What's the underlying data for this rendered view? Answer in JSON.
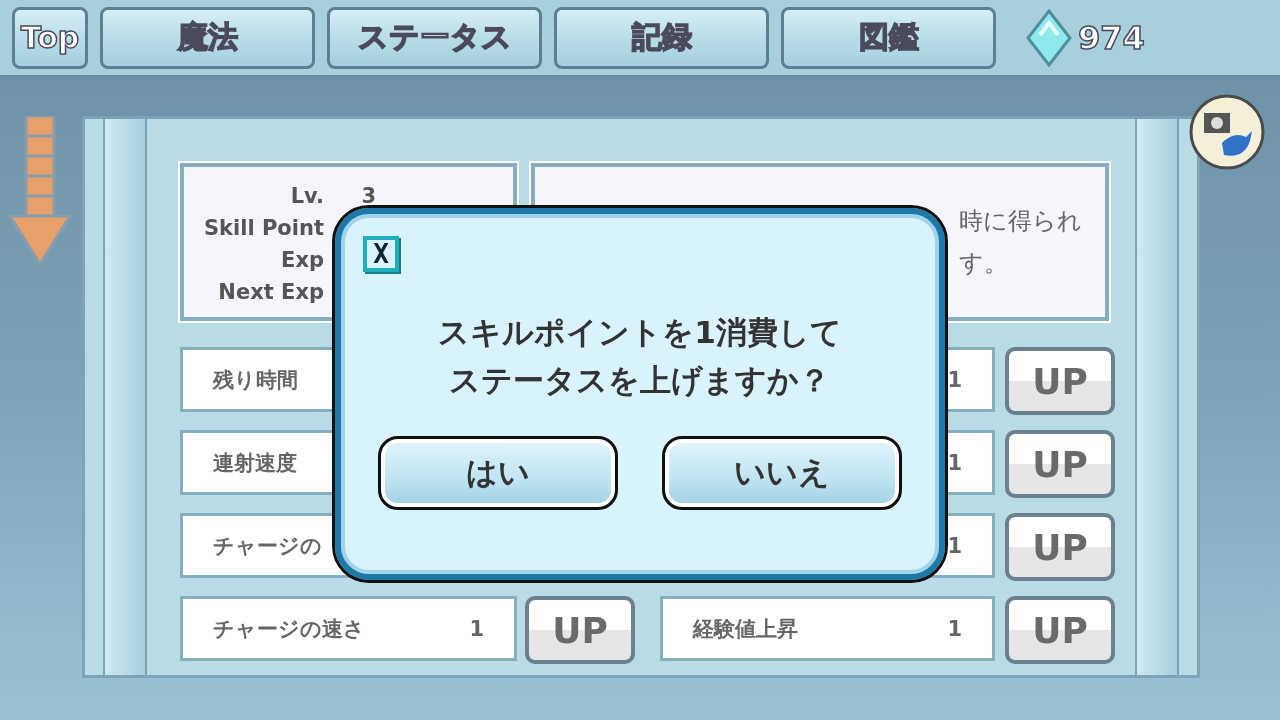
{
  "nav": {
    "top": "Top",
    "tabs": [
      "魔法",
      "ステータス",
      "記録",
      "図鑑"
    ],
    "gems": "974"
  },
  "info": {
    "lines": [
      {
        "label": "Lv.",
        "value": "3"
      },
      {
        "label": "Skill Point"
      },
      {
        "label": "Exp"
      },
      {
        "label": "Next Exp"
      }
    ],
    "description": [
      "時に得られ",
      "す。"
    ]
  },
  "stats": {
    "left": [
      {
        "name": "残り時間"
      },
      {
        "name": "連射速度"
      },
      {
        "name": "チャージの"
      },
      {
        "name": "チャージの速さ",
        "value": "1",
        "button": "UP"
      }
    ],
    "right": [
      {
        "value": "1",
        "button": "UP"
      },
      {
        "value": "1",
        "button": "UP"
      },
      {
        "value": "1",
        "button": "UP"
      },
      {
        "name": "経験値上昇",
        "value": "1",
        "button": "UP"
      }
    ]
  },
  "dialog": {
    "close": "X",
    "message": [
      "スキルポイントを1消費して",
      "ステータスを上げますか？"
    ],
    "buttons": [
      "はい",
      "いいえ"
    ]
  }
}
